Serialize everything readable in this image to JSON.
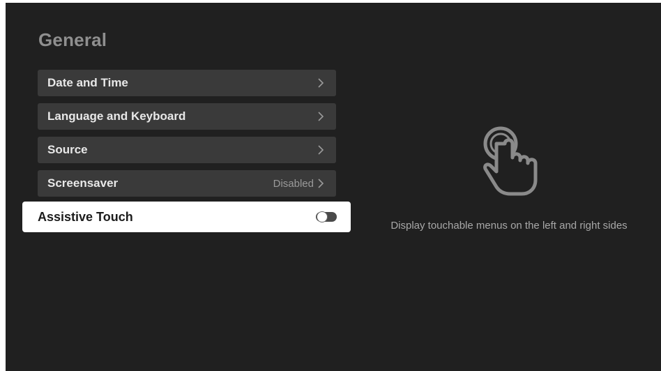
{
  "page": {
    "title": "General"
  },
  "menu": {
    "items": [
      {
        "label": "Date and Time",
        "value": ""
      },
      {
        "label": "Language and Keyboard",
        "value": ""
      },
      {
        "label": "Source",
        "value": ""
      },
      {
        "label": "Screensaver",
        "value": "Disabled"
      }
    ],
    "focused_item": {
      "label": "Assistive Touch",
      "toggle_state": "off"
    }
  },
  "detail": {
    "icon": "touch-hand-icon",
    "description": "Display touchable menus on the left and right sides"
  },
  "colors": {
    "background": "#202020",
    "item_background": "#3a3a3a",
    "focused_background": "#ffffff",
    "title": "#8f8f8f"
  }
}
